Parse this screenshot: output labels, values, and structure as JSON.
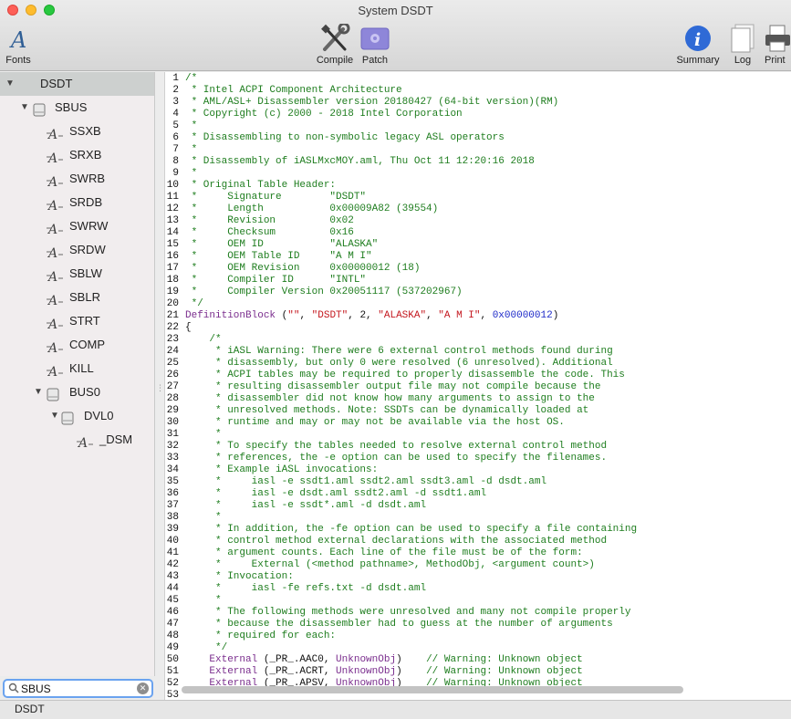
{
  "window": {
    "title": "System DSDT"
  },
  "toolbar": {
    "fonts": "Fonts",
    "compile": "Compile",
    "patch": "Patch",
    "summary": "Summary",
    "log": "Log",
    "print": "Print"
  },
  "sidebar": {
    "items": [
      {
        "label": "DSDT",
        "level": 0,
        "arrow": "▼",
        "icon": "none",
        "selected": true
      },
      {
        "label": "SBUS",
        "level": 1,
        "arrow": "▼",
        "icon": "device-icon"
      },
      {
        "label": "SSXB",
        "level": 2,
        "icon": "method-icon"
      },
      {
        "label": "SRXB",
        "level": 2,
        "icon": "method-icon"
      },
      {
        "label": "SWRB",
        "level": 2,
        "icon": "method-icon"
      },
      {
        "label": "SRDB",
        "level": 2,
        "icon": "method-icon"
      },
      {
        "label": "SWRW",
        "level": 2,
        "icon": "method-icon"
      },
      {
        "label": "SRDW",
        "level": 2,
        "icon": "method-icon"
      },
      {
        "label": "SBLW",
        "level": 2,
        "icon": "method-icon"
      },
      {
        "label": "SBLR",
        "level": 2,
        "icon": "method-icon"
      },
      {
        "label": "STRT",
        "level": 2,
        "icon": "method-icon"
      },
      {
        "label": "COMP",
        "level": 2,
        "icon": "method-icon"
      },
      {
        "label": "KILL",
        "level": 2,
        "icon": "method-icon"
      },
      {
        "label": "BUS0",
        "level": 2,
        "arrow": "▼",
        "icon": "device-icon"
      },
      {
        "label": "DVL0",
        "level": 3,
        "arrow": "▼",
        "icon": "device-icon"
      },
      {
        "label": "_DSM",
        "level": 4,
        "icon": "method-icon"
      }
    ]
  },
  "search": {
    "value": "SBUS"
  },
  "status": {
    "text": "DSDT"
  },
  "code": {
    "lines": [
      {
        "n": "1",
        "segs": [
          [
            "c",
            "/*"
          ]
        ]
      },
      {
        "n": "2",
        "segs": [
          [
            "c",
            " * Intel ACPI Component Architecture"
          ]
        ]
      },
      {
        "n": "3",
        "segs": [
          [
            "c",
            " * AML/ASL+ Disassembler version 20180427 (64-bit version)(RM)"
          ]
        ]
      },
      {
        "n": "4",
        "segs": [
          [
            "c",
            " * Copyright (c) 2000 - 2018 Intel Corporation"
          ]
        ]
      },
      {
        "n": "5",
        "segs": [
          [
            "c",
            " *"
          ]
        ]
      },
      {
        "n": "6",
        "segs": [
          [
            "c",
            " * Disassembling to non-symbolic legacy ASL operators"
          ]
        ]
      },
      {
        "n": "7",
        "segs": [
          [
            "c",
            " *"
          ]
        ]
      },
      {
        "n": "8",
        "segs": [
          [
            "c",
            " * Disassembly of iASLMxcMOY.aml, Thu Oct 11 12:20:16 2018"
          ]
        ]
      },
      {
        "n": "9",
        "segs": [
          [
            "c",
            " *"
          ]
        ]
      },
      {
        "n": "10",
        "segs": [
          [
            "c",
            " * Original Table Header:"
          ]
        ]
      },
      {
        "n": "11",
        "segs": [
          [
            "c",
            " *     Signature        \"DSDT\""
          ]
        ]
      },
      {
        "n": "12",
        "segs": [
          [
            "c",
            " *     Length           0x00009A82 (39554)"
          ]
        ]
      },
      {
        "n": "13",
        "segs": [
          [
            "c",
            " *     Revision         0x02"
          ]
        ]
      },
      {
        "n": "14",
        "segs": [
          [
            "c",
            " *     Checksum         0x16"
          ]
        ]
      },
      {
        "n": "15",
        "segs": [
          [
            "c",
            " *     OEM ID           \"ALASKA\""
          ]
        ]
      },
      {
        "n": "16",
        "segs": [
          [
            "c",
            " *     OEM Table ID     \"A M I\""
          ]
        ]
      },
      {
        "n": "17",
        "segs": [
          [
            "c",
            " *     OEM Revision     0x00000012 (18)"
          ]
        ]
      },
      {
        "n": "18",
        "segs": [
          [
            "c",
            " *     Compiler ID      \"INTL\""
          ]
        ]
      },
      {
        "n": "19",
        "segs": [
          [
            "c",
            " *     Compiler Version 0x20051117 (537202967)"
          ]
        ]
      },
      {
        "n": "20",
        "segs": [
          [
            "c",
            " */"
          ]
        ]
      },
      {
        "n": "21",
        "segs": [
          [
            "k",
            "DefinitionBlock"
          ],
          [
            "p",
            " ("
          ],
          [
            "s",
            "\"\""
          ],
          [
            "p",
            ", "
          ],
          [
            "s",
            "\"DSDT\""
          ],
          [
            "p",
            ", 2, "
          ],
          [
            "s",
            "\"ALASKA\""
          ],
          [
            "p",
            ", "
          ],
          [
            "s",
            "\"A M I\""
          ],
          [
            "p",
            ", "
          ],
          [
            "n",
            "0x00000012"
          ],
          [
            "p",
            ")"
          ]
        ]
      },
      {
        "n": "22",
        "segs": [
          [
            "p",
            "{"
          ]
        ]
      },
      {
        "n": "23",
        "segs": [
          [
            "c",
            "    /*"
          ]
        ]
      },
      {
        "n": "24",
        "segs": [
          [
            "c",
            "     * iASL Warning: There were 6 external control methods found during"
          ]
        ]
      },
      {
        "n": "25",
        "segs": [
          [
            "c",
            "     * disassembly, but only 0 were resolved (6 unresolved). Additional"
          ]
        ]
      },
      {
        "n": "26",
        "segs": [
          [
            "c",
            "     * ACPI tables may be required to properly disassemble the code. This"
          ]
        ]
      },
      {
        "n": "27",
        "segs": [
          [
            "c",
            "     * resulting disassembler output file may not compile because the"
          ]
        ]
      },
      {
        "n": "28",
        "segs": [
          [
            "c",
            "     * disassembler did not know how many arguments to assign to the"
          ]
        ]
      },
      {
        "n": "29",
        "segs": [
          [
            "c",
            "     * unresolved methods. Note: SSDTs can be dynamically loaded at"
          ]
        ]
      },
      {
        "n": "30",
        "segs": [
          [
            "c",
            "     * runtime and may or may not be available via the host OS."
          ]
        ]
      },
      {
        "n": "31",
        "segs": [
          [
            "c",
            "     *"
          ]
        ]
      },
      {
        "n": "32",
        "segs": [
          [
            "c",
            "     * To specify the tables needed to resolve external control method"
          ]
        ]
      },
      {
        "n": "33",
        "segs": [
          [
            "c",
            "     * references, the -e option can be used to specify the filenames."
          ]
        ]
      },
      {
        "n": "34",
        "segs": [
          [
            "c",
            "     * Example iASL invocations:"
          ]
        ]
      },
      {
        "n": "35",
        "segs": [
          [
            "c",
            "     *     iasl -e ssdt1.aml ssdt2.aml ssdt3.aml -d dsdt.aml"
          ]
        ]
      },
      {
        "n": "36",
        "segs": [
          [
            "c",
            "     *     iasl -e dsdt.aml ssdt2.aml -d ssdt1.aml"
          ]
        ]
      },
      {
        "n": "37",
        "segs": [
          [
            "c",
            "     *     iasl -e ssdt*.aml -d dsdt.aml"
          ]
        ]
      },
      {
        "n": "38",
        "segs": [
          [
            "c",
            "     *"
          ]
        ]
      },
      {
        "n": "39",
        "segs": [
          [
            "c",
            "     * In addition, the -fe option can be used to specify a file containing"
          ]
        ]
      },
      {
        "n": "40",
        "segs": [
          [
            "c",
            "     * control method external declarations with the associated method"
          ]
        ]
      },
      {
        "n": "41",
        "segs": [
          [
            "c",
            "     * argument counts. Each line of the file must be of the form:"
          ]
        ]
      },
      {
        "n": "42",
        "segs": [
          [
            "c",
            "     *     External (<method pathname>, MethodObj, <argument count>)"
          ]
        ]
      },
      {
        "n": "43",
        "segs": [
          [
            "c",
            "     * Invocation:"
          ]
        ]
      },
      {
        "n": "44",
        "segs": [
          [
            "c",
            "     *     iasl -fe refs.txt -d dsdt.aml"
          ]
        ]
      },
      {
        "n": "45",
        "segs": [
          [
            "c",
            "     *"
          ]
        ]
      },
      {
        "n": "46",
        "segs": [
          [
            "c",
            "     * The following methods were unresolved and many not compile properly"
          ]
        ]
      },
      {
        "n": "47",
        "segs": [
          [
            "c",
            "     * because the disassembler had to guess at the number of arguments"
          ]
        ]
      },
      {
        "n": "48",
        "segs": [
          [
            "c",
            "     * required for each:"
          ]
        ]
      },
      {
        "n": "49",
        "segs": [
          [
            "c",
            "     */"
          ]
        ]
      },
      {
        "n": "50",
        "segs": [
          [
            "k",
            "    External"
          ],
          [
            "p",
            " (_PR_.AAC0, "
          ],
          [
            "k",
            "UnknownObj"
          ],
          [
            "p",
            ")    "
          ],
          [
            "c",
            "// Warning: Unknown object"
          ]
        ]
      },
      {
        "n": "51",
        "segs": [
          [
            "k",
            "    External"
          ],
          [
            "p",
            " (_PR_.ACRT, "
          ],
          [
            "k",
            "UnknownObj"
          ],
          [
            "p",
            ")    "
          ],
          [
            "c",
            "// Warning: Unknown object"
          ]
        ]
      },
      {
        "n": "52",
        "segs": [
          [
            "k",
            "    External"
          ],
          [
            "p",
            " (_PR_.APSV, "
          ],
          [
            "k",
            "UnknownObj"
          ],
          [
            "p",
            ")    "
          ],
          [
            "c",
            "// Warning: Unknown object"
          ]
        ]
      },
      {
        "n": "53",
        "segs": [
          [
            "p",
            ""
          ]
        ]
      }
    ]
  }
}
